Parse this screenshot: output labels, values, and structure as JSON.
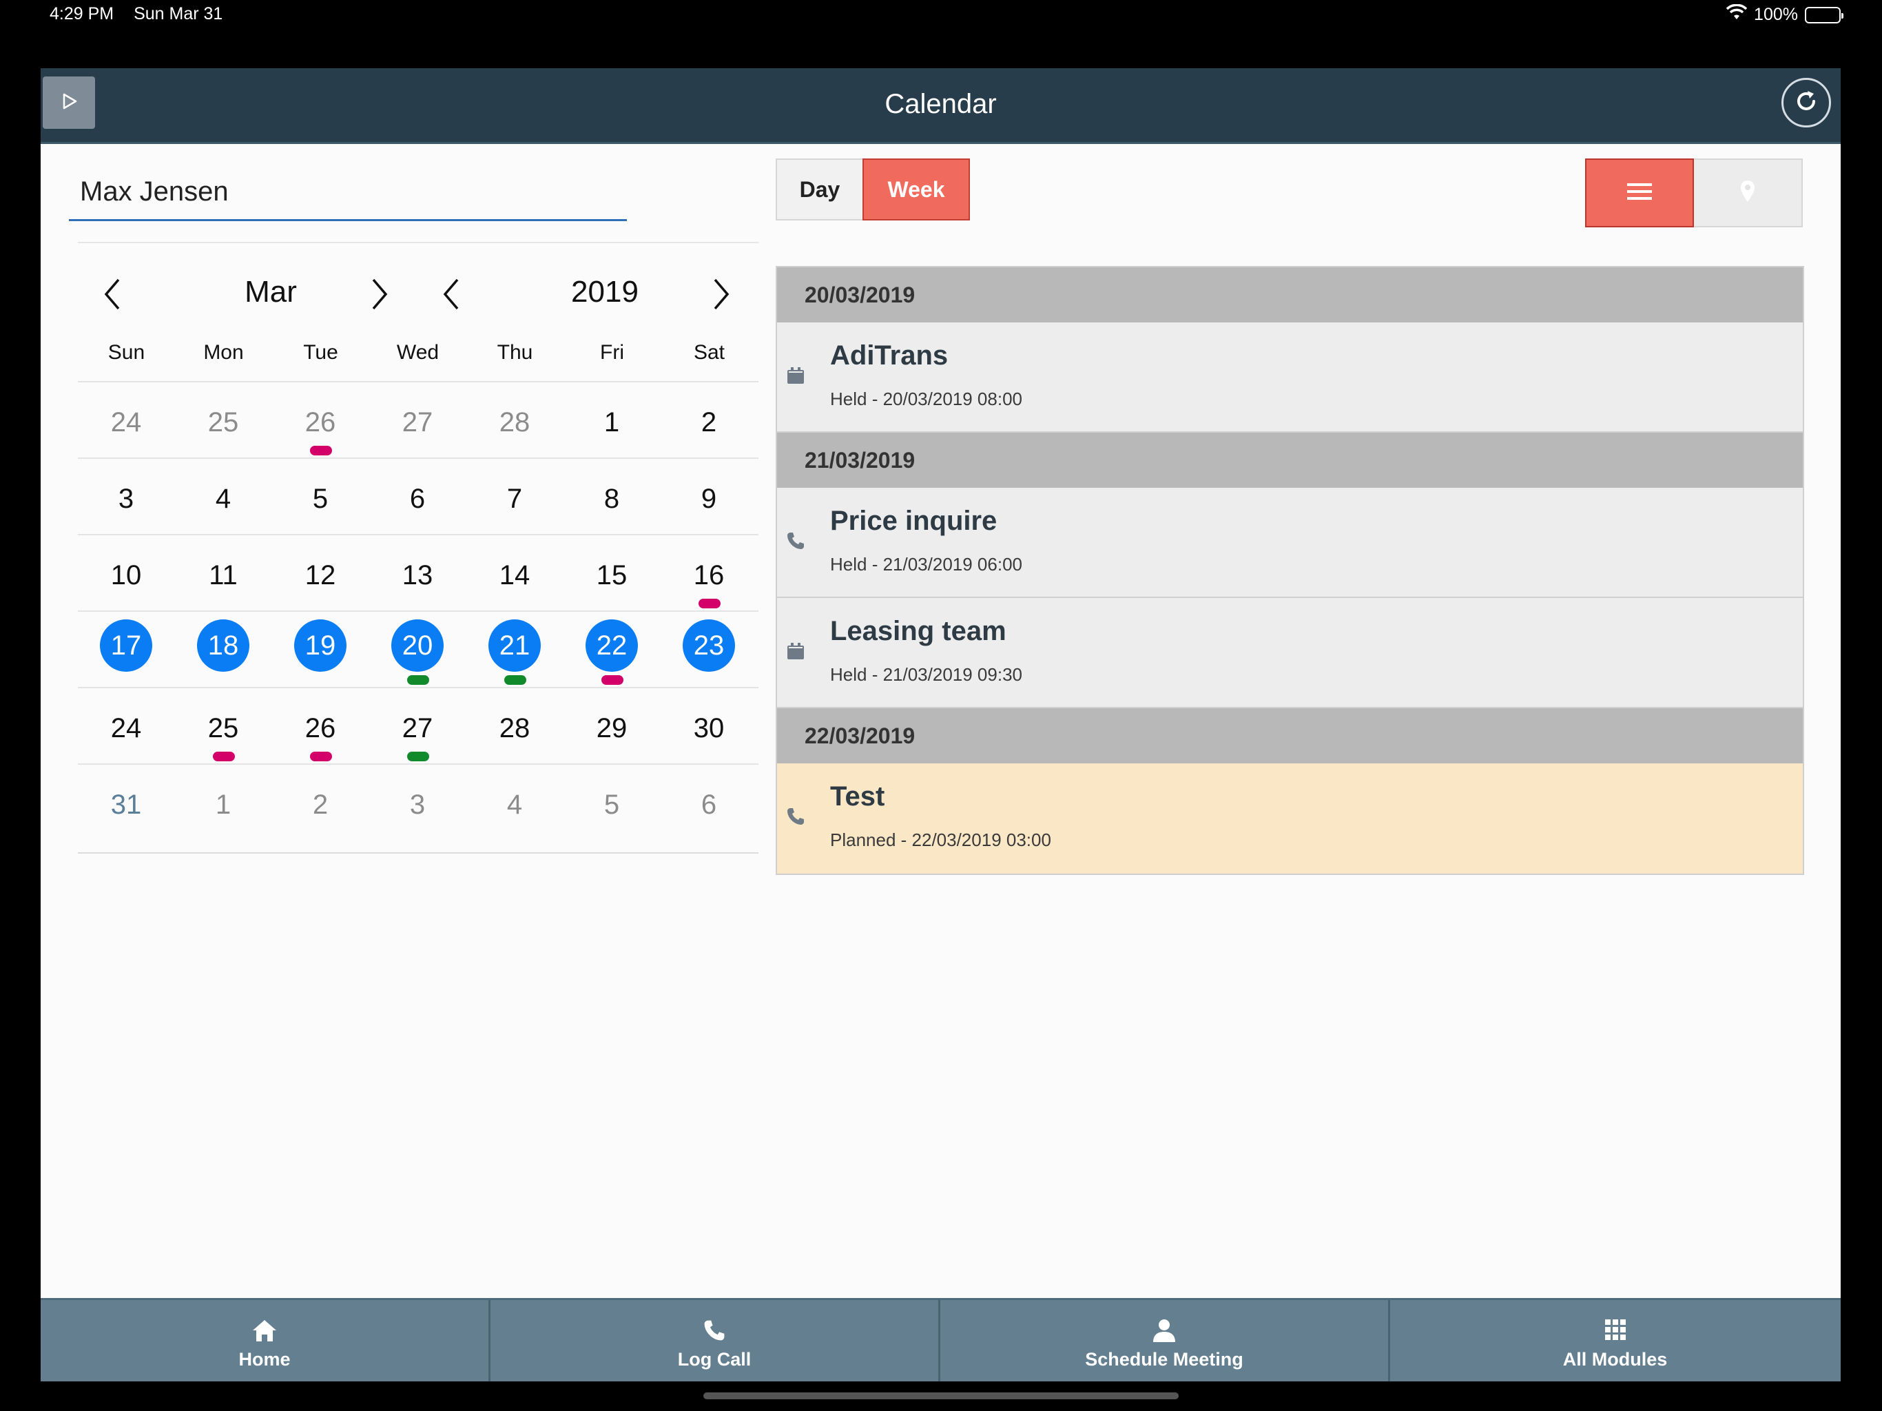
{
  "status_bar": {
    "time": "4:29 PM",
    "date": "Sun Mar 31",
    "battery": "100%"
  },
  "header": {
    "title": "Calendar"
  },
  "user_field": {
    "value": "Max Jensen"
  },
  "calendar": {
    "month": "Mar",
    "year": "2019",
    "weekdays": [
      "Sun",
      "Mon",
      "Tue",
      "Wed",
      "Thu",
      "Fri",
      "Sat"
    ],
    "weeks": [
      [
        {
          "d": "24",
          "m": true
        },
        {
          "d": "25",
          "m": true
        },
        {
          "d": "26",
          "m": true,
          "dot": "#d4006a"
        },
        {
          "d": "27",
          "m": true
        },
        {
          "d": "28",
          "m": true
        },
        {
          "d": "1"
        },
        {
          "d": "2"
        }
      ],
      [
        {
          "d": "3"
        },
        {
          "d": "4"
        },
        {
          "d": "5"
        },
        {
          "d": "6"
        },
        {
          "d": "7"
        },
        {
          "d": "8"
        },
        {
          "d": "9"
        }
      ],
      [
        {
          "d": "10"
        },
        {
          "d": "11"
        },
        {
          "d": "12"
        },
        {
          "d": "13"
        },
        {
          "d": "14"
        },
        {
          "d": "15"
        },
        {
          "d": "16",
          "dot": "#d4006a"
        }
      ],
      [
        {
          "d": "17",
          "s": true
        },
        {
          "d": "18",
          "s": true
        },
        {
          "d": "19",
          "s": true
        },
        {
          "d": "20",
          "s": true,
          "dot": "#118a2b"
        },
        {
          "d": "21",
          "s": true,
          "dot": "#118a2b"
        },
        {
          "d": "22",
          "s": true,
          "dot": "#d4006a"
        },
        {
          "d": "23",
          "s": true
        }
      ],
      [
        {
          "d": "24"
        },
        {
          "d": "25",
          "dot": "#d4006a"
        },
        {
          "d": "26",
          "dot": "#d4006a"
        },
        {
          "d": "27",
          "dot": "#118a2b"
        },
        {
          "d": "28"
        },
        {
          "d": "29"
        },
        {
          "d": "30"
        }
      ],
      [
        {
          "d": "31",
          "m": true,
          "blue": true
        },
        {
          "d": "1",
          "m": true
        },
        {
          "d": "2",
          "m": true
        },
        {
          "d": "3",
          "m": true
        },
        {
          "d": "4",
          "m": true
        },
        {
          "d": "5",
          "m": true
        },
        {
          "d": "6",
          "m": true
        }
      ]
    ]
  },
  "view_toggle": {
    "day": "Day",
    "week": "Week",
    "active": "Week"
  },
  "mode_toggle": {
    "active": "list"
  },
  "agenda": [
    {
      "date": "20/03/2019",
      "events": [
        {
          "title": "AdiTrans",
          "subtitle": "Held - 20/03/2019 08:00",
          "icon": "calendar-icon",
          "planned": false
        }
      ]
    },
    {
      "date": "21/03/2019",
      "events": [
        {
          "title": "Price inquire",
          "subtitle": "Held - 21/03/2019 06:00",
          "icon": "phone-icon",
          "planned": false
        },
        {
          "title": "Leasing team",
          "subtitle": "Held - 21/03/2019 09:30",
          "icon": "calendar-icon",
          "planned": false
        }
      ]
    },
    {
      "date": "22/03/2019",
      "events": [
        {
          "title": "Test",
          "subtitle": "Planned - 22/03/2019 03:00",
          "icon": "phone-icon",
          "planned": true
        }
      ]
    }
  ],
  "bottom_nav": [
    {
      "label": "Home",
      "icon": "home-icon"
    },
    {
      "label": "Log Call",
      "icon": "phone-icon"
    },
    {
      "label": "Schedule Meeting",
      "icon": "person-icon"
    },
    {
      "label": "All Modules",
      "icon": "grid-icon"
    }
  ],
  "colors": {
    "accent": "#f06a5d",
    "selected": "#0a7df5",
    "header": "#283d4c",
    "nav": "#637f90",
    "dot_pink": "#d4006a",
    "dot_green": "#118a2b",
    "planned": "#fae7c6"
  }
}
